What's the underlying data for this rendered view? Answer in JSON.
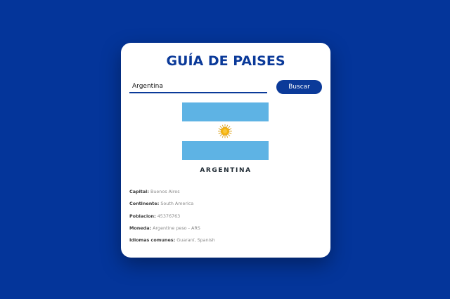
{
  "app": {
    "title": "GUÍA DE PAISES"
  },
  "search": {
    "value": "Argentina",
    "button_label": "Buscar"
  },
  "colors": {
    "background": "#04359a",
    "accent": "#0b3a99",
    "flag_blue": "#5eb3e4",
    "flag_sun": "#f6b40e"
  },
  "country": {
    "flag_icon": "argentina-flag",
    "name": "ARGENTINA",
    "details": [
      {
        "label": "Capital:",
        "value": "Buenos Aires"
      },
      {
        "label": "Continente:",
        "value": "South America"
      },
      {
        "label": "Poblacion:",
        "value": "45376763"
      },
      {
        "label": "Moneda:",
        "value": "Argentine peso - ARS"
      },
      {
        "label": "Idiomas comunes:",
        "value": "Guaraní, Spanish"
      }
    ]
  }
}
